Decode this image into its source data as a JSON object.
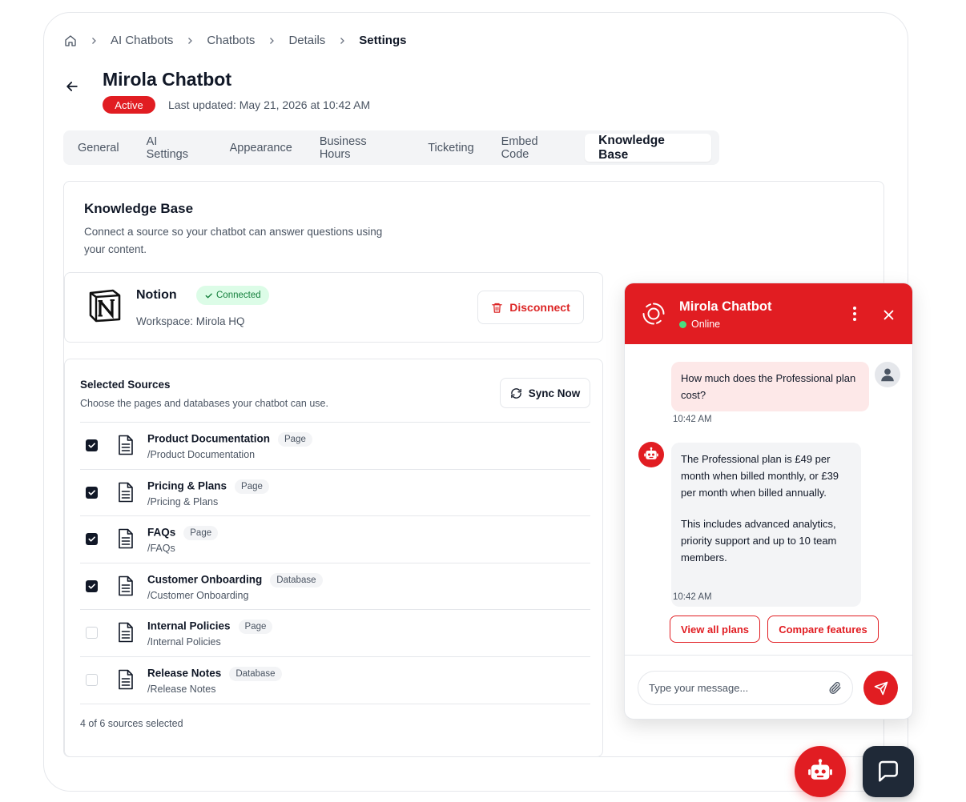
{
  "breadcrumb": {
    "home_icon": "home-icon",
    "items": [
      "AI Chatbots",
      "Chatbots",
      "Details"
    ],
    "current": "Settings"
  },
  "header": {
    "title": "Mirola Chatbot",
    "status": "Active",
    "last_updated": "Last updated: May 21, 2026 at 10:42 AM"
  },
  "tabs": [
    "General",
    "AI Settings",
    "Appearance",
    "Business Hours",
    "Ticketing",
    "Embed Code",
    "Knowledge Base"
  ],
  "active_tab": "Knowledge Base",
  "knowledge_base": {
    "title": "Knowledge Base",
    "description": "Connect a source so your chatbot can answer questions using your content.",
    "integration": {
      "name": "Notion",
      "status": "Connected",
      "workspace": "Workspace: Mirola HQ",
      "disconnect_label": "Disconnect"
    }
  },
  "sources": {
    "title": "Selected Sources",
    "description": "Choose the pages and databases your chatbot can use.",
    "sync_label": "Sync Now",
    "items": [
      {
        "name": "Product Documentation",
        "type": "Page",
        "path": "/Product Documentation",
        "checked": true
      },
      {
        "name": "Pricing & Plans",
        "type": "Page",
        "path": "/Pricing & Plans",
        "checked": true
      },
      {
        "name": "FAQs",
        "type": "Page",
        "path": "/FAQs",
        "checked": true
      },
      {
        "name": "Customer Onboarding",
        "type": "Database",
        "path": "/Customer Onboarding",
        "checked": true
      },
      {
        "name": "Internal Policies",
        "type": "Page",
        "path": "/Internal Policies",
        "checked": false
      },
      {
        "name": "Release Notes",
        "type": "Database",
        "path": "/Release Notes",
        "checked": false
      }
    ],
    "count_text": "4 of 6 sources selected"
  },
  "chat": {
    "title": "Mirola Chatbot",
    "status": "Online",
    "user_message": "How much does the Professional plan cost?",
    "user_time": "10:42 AM",
    "bot_message_1": "The Professional plan is £49 per month when billed monthly, or £39 per month when billed annually.",
    "bot_message_2": "This includes advanced analytics, priority support and up to 10 team members.",
    "bot_time": "10:42 AM",
    "actions": [
      "View all plans",
      "Compare features"
    ],
    "input_placeholder": "Type your message..."
  },
  "colors": {
    "brand": "#e11d22",
    "dark": "#1f2937",
    "success_bg": "#dcfce7",
    "success_text": "#15803d"
  }
}
